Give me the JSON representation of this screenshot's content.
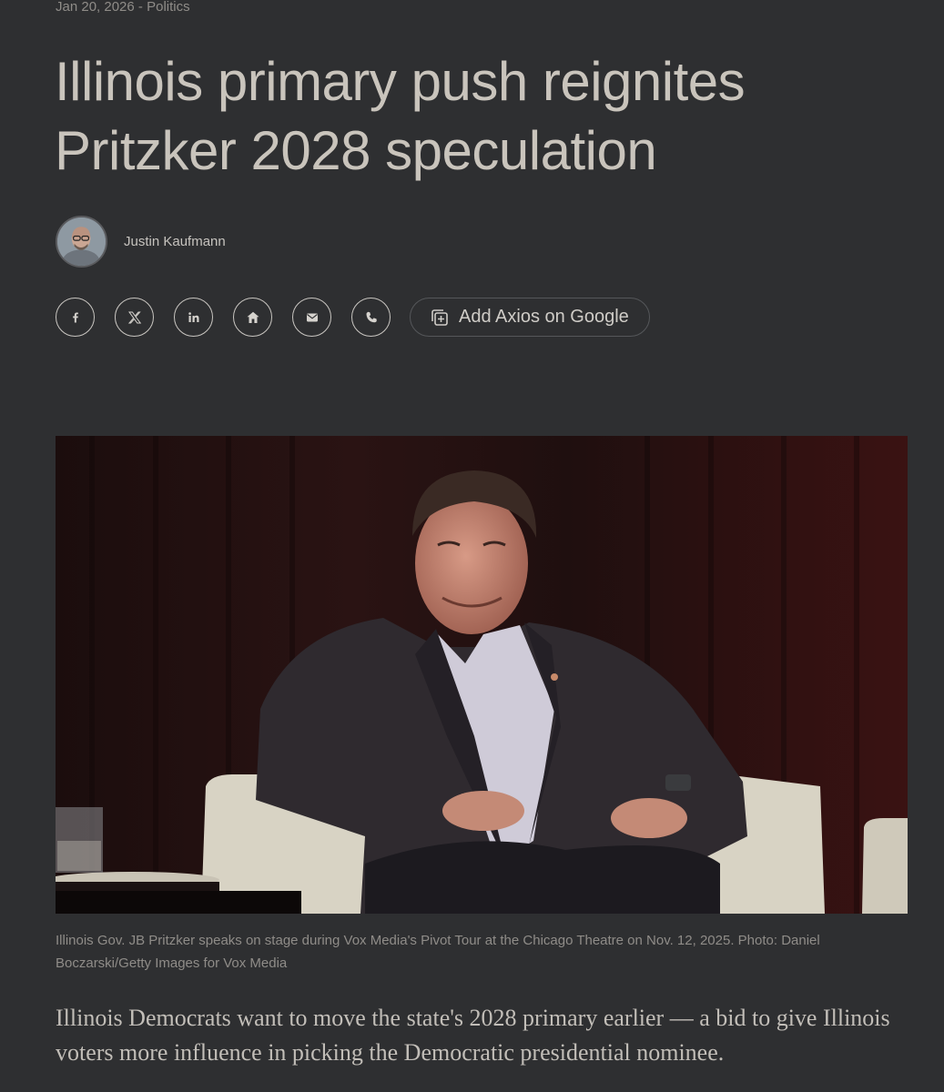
{
  "article": {
    "date": "Jan 20, 2026",
    "separator": " - ",
    "section": "Politics",
    "headline": "Illinois primary push reignites Pritzker 2028 speculation",
    "author": "Justin Kaufmann",
    "caption": "Illinois Gov. JB Pritzker speaks on stage during Vox Media's Pivot Tour at the Chicago Theatre on Nov. 12, 2025. Photo: Daniel Boczarski/Getty Images for Vox Media",
    "lede": "Illinois Democrats want to move the state's 2028 primary earlier — a bid to give Illinois voters more influence in picking the Democratic presidential nominee."
  },
  "share": {
    "buttons": [
      {
        "icon": "facebook-icon"
      },
      {
        "icon": "x-icon"
      },
      {
        "icon": "linkedin-icon"
      },
      {
        "icon": "home-icon"
      },
      {
        "icon": "email-icon"
      },
      {
        "icon": "phone-icon"
      }
    ],
    "google_label": "Add Axios on Google"
  },
  "colors": {
    "background": "#2e2f31",
    "headline": "#c9c4bc",
    "muted": "#8f8c88"
  }
}
